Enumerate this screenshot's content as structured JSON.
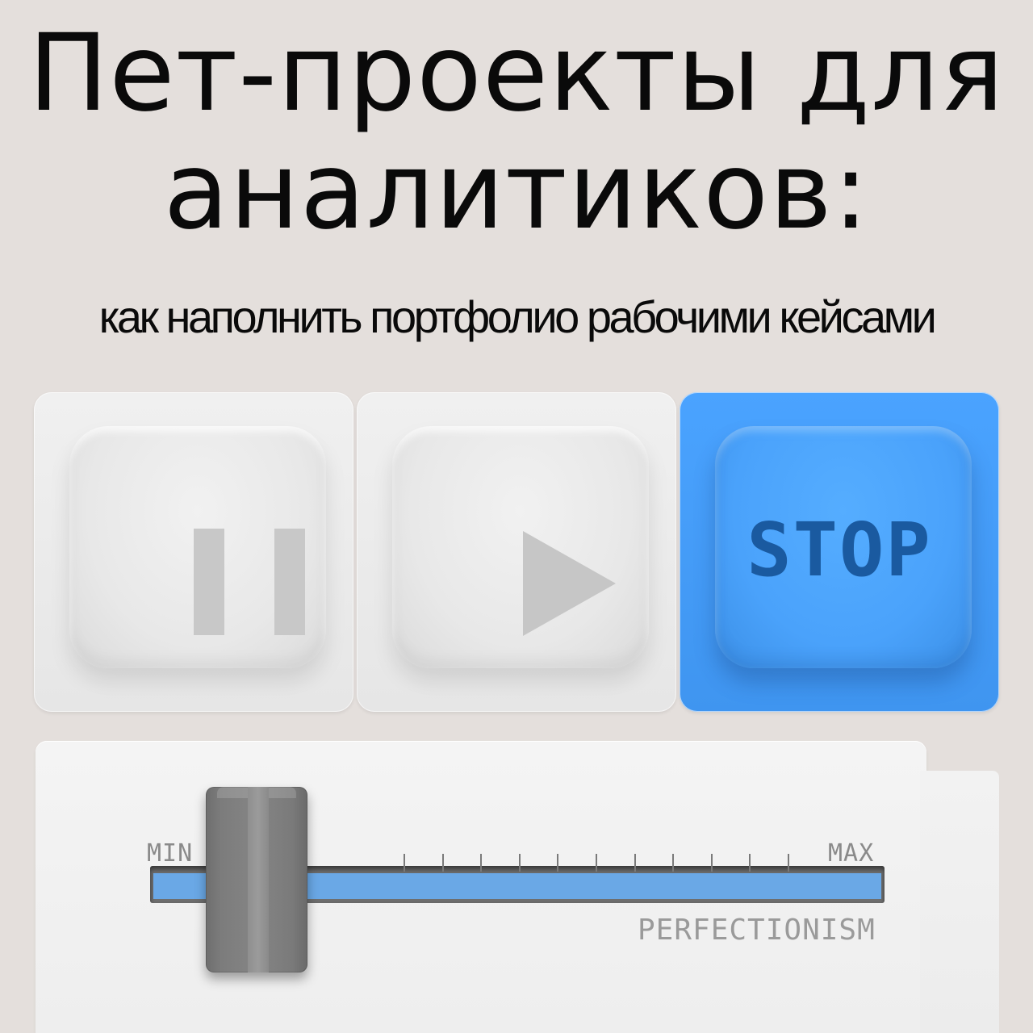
{
  "title": {
    "line1": "Пет-проекты для",
    "line2": "аналитиков:"
  },
  "subtitle": "как наполнить портфолио рабочими кейсами",
  "keys": {
    "pause_icon": "pause-icon",
    "play_icon": "play-icon",
    "stop_label": "STOP"
  },
  "fader": {
    "min_label": "MIN",
    "max_label": "MAX",
    "caption": "PERFECTIONISM",
    "level": 0.1,
    "tick_count": 12
  },
  "colors": {
    "background": "#e4dfdc",
    "key_light": "#eeeeee",
    "key_blue": "#4aa2fb",
    "stop_text": "#1a5aa0",
    "track_blue": "#6aa8e6",
    "knob_gray": "#7f7f7f"
  }
}
